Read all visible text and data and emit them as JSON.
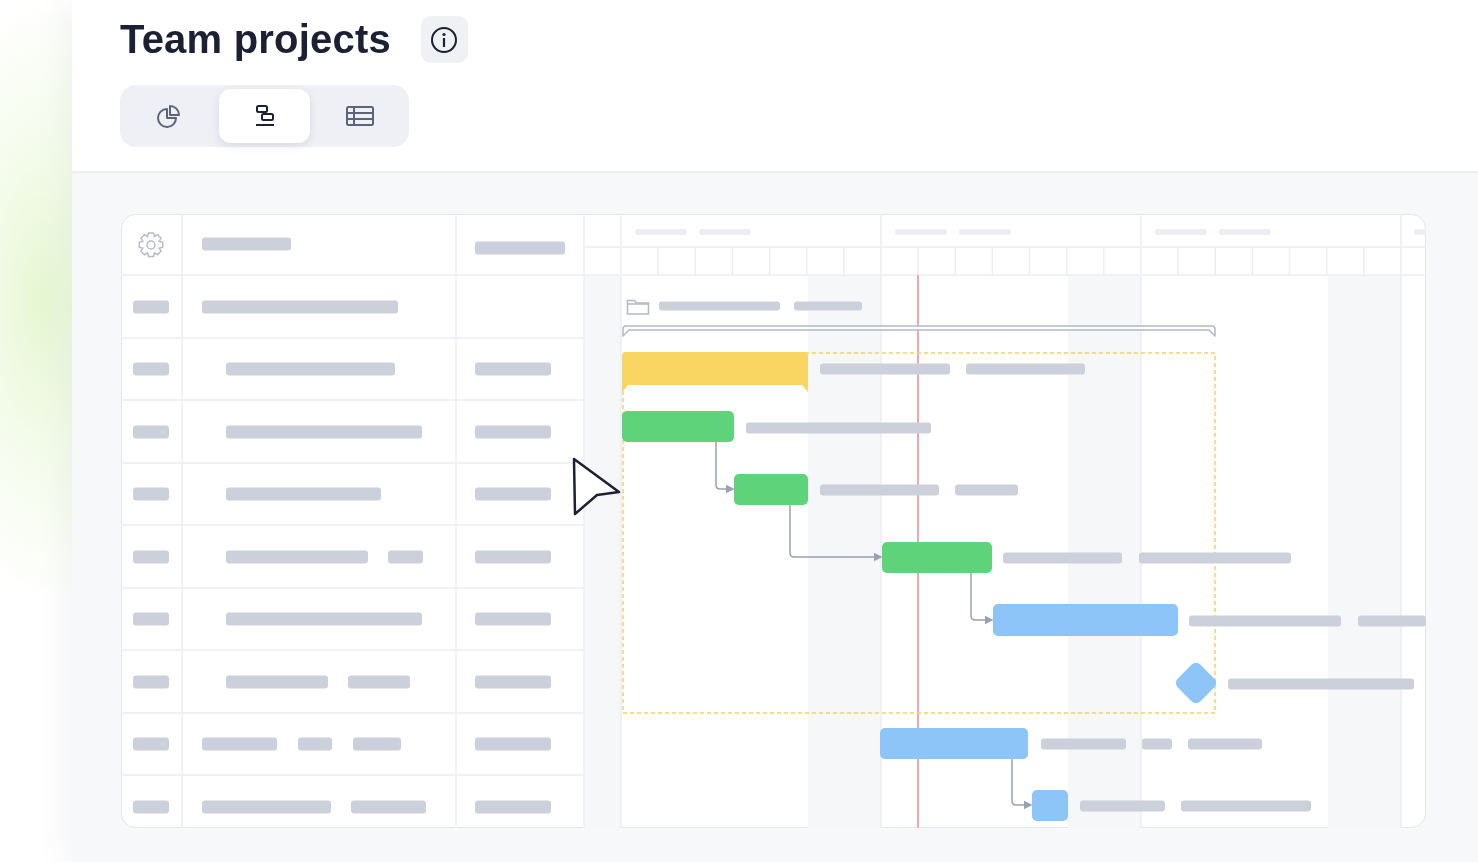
{
  "title": "Team projects",
  "view_tabs": [
    {
      "kind": "chart",
      "selected": false
    },
    {
      "kind": "gantt",
      "selected": true
    },
    {
      "kind": "table",
      "selected": false
    }
  ]
}
